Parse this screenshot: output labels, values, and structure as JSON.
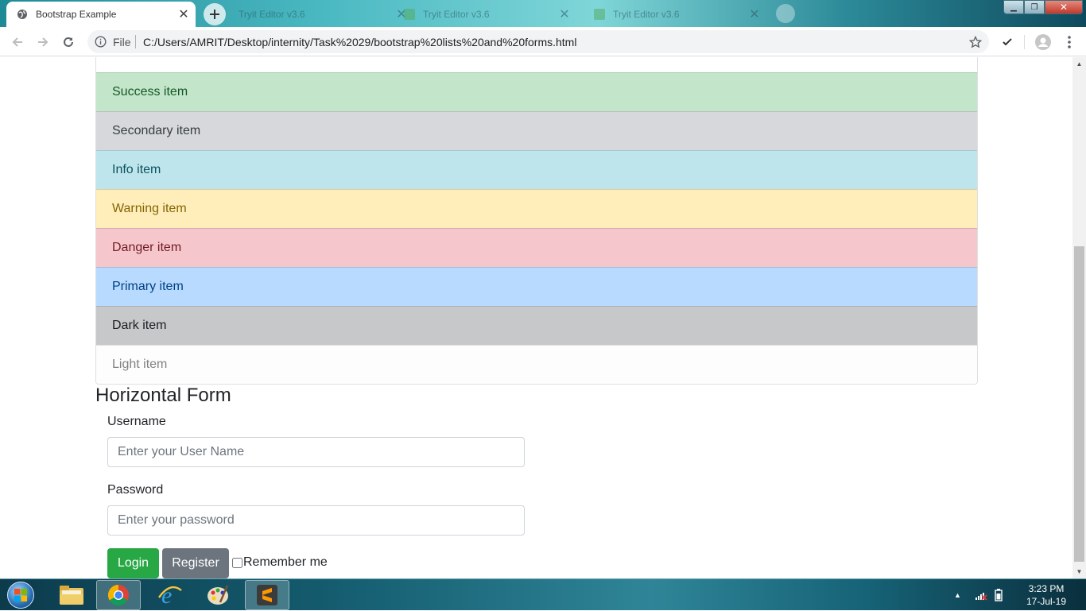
{
  "browser": {
    "active_tab_title": "Bootstrap Example",
    "ghost_tab_1": "Tryit Editor v3.6",
    "ghost_tab_2": "Tryit Editor v3.6",
    "file_label": "File",
    "url": "C:/Users/AMRIT/Desktop/internity/Task%2029/bootstrap%20lists%20and%20forms.html"
  },
  "list": {
    "items": [
      {
        "label": "Success item",
        "variant": "success"
      },
      {
        "label": "Secondary item",
        "variant": "secondary"
      },
      {
        "label": "Info item",
        "variant": "info"
      },
      {
        "label": "Warning item",
        "variant": "warning"
      },
      {
        "label": "Danger item",
        "variant": "danger"
      },
      {
        "label": "Primary item",
        "variant": "primary"
      },
      {
        "label": "Dark item",
        "variant": "dark"
      },
      {
        "label": "Light item",
        "variant": "light"
      }
    ]
  },
  "form": {
    "title": "Horizontal Form",
    "username_label": "Username",
    "username_placeholder": "Enter your User Name",
    "username_value": "",
    "password_label": "Password",
    "password_placeholder": "Enter your password",
    "password_value": "",
    "login_label": "Login",
    "register_label": "Register",
    "remember_label": "Remember me",
    "remember_checked": false
  },
  "taskbar": {
    "apps": [
      "windows-explorer",
      "google-chrome",
      "internet-explorer",
      "paint",
      "sublime-text"
    ],
    "active_app": "google-chrome",
    "time": "3:23 PM",
    "date": "17-Jul-19"
  },
  "colors": {
    "success_btn": "#28a745",
    "secondary_btn": "#6c757d"
  }
}
